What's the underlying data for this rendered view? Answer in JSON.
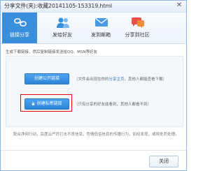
{
  "window": {
    "title": "分享文件(夹):收藏20141105-153319.html",
    "close_icon": "close-icon"
  },
  "tabs": [
    {
      "label": "链接分享",
      "icon": "link-share-icon",
      "active": true
    },
    {
      "label": "发给好友",
      "icon": "friends-icon",
      "active": false
    },
    {
      "label": "发到邮箱",
      "icon": "mail-icon",
      "active": false
    },
    {
      "label": "分享到社区",
      "icon": "community-icon",
      "active": false
    }
  ],
  "hint": "生成下载链接，然后复制链接发送给QQ、MSN等好友",
  "public": {
    "button_label": "创建公开链接",
    "description_prefix": "（文件会出现在你的",
    "description_link": "分享主页",
    "description_suffix": "，其他人都能查看下载）"
  },
  "private": {
    "button_label": "创建私密链接",
    "description": "（只有分享的好友能看到，其他人都看不到）"
  },
  "note": "配合净网行动，百度云严厉打击不良信息，色情低俗信息的传播行为，如经发现，或将处罚处理。",
  "footer": {
    "close_label": "关闭"
  },
  "colors": {
    "accent": "#3a8fdc",
    "highlight": "#e60012"
  }
}
